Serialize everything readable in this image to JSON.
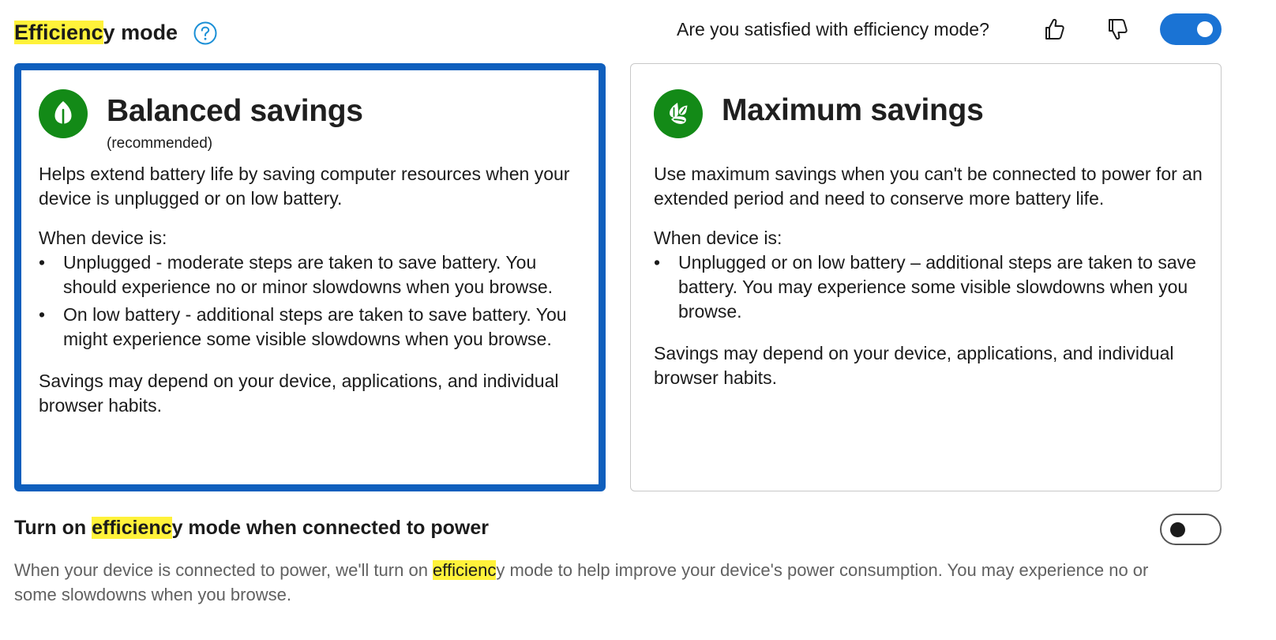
{
  "header": {
    "title_highlight": "Efficienc",
    "title_rest": "y mode",
    "help_icon": "question-circle-icon",
    "feedback_question": "Are you satisfied with efficiency mode?",
    "thumbs_up_icon": "thumbs-up-icon",
    "thumbs_down_icon": "thumbs-down-icon",
    "efficiency_toggle_on": true
  },
  "cards": {
    "balanced": {
      "icon": "leaf-icon",
      "title": "Balanced savings",
      "subtitle": "(recommended)",
      "description": "Helps extend battery life by saving computer resources when your device is unplugged or on low battery.",
      "when_label": "When device is:",
      "bullets": [
        "Unplugged - moderate steps are taken to save battery. You should experience no or minor slowdowns when you browse.",
        "On low battery - additional steps are taken to save battery. You might experience some visible slowdowns when you browse."
      ],
      "footer": "Savings may depend on your device, applications, and individual browser habits.",
      "selected": true
    },
    "maximum": {
      "icon": "leaves-icon",
      "title": "Maximum savings",
      "description": "Use maximum savings when you can't be connected to power for an extended period and need to conserve more battery life.",
      "when_label": "When device is:",
      "bullets": [
        "Unplugged or on low battery – additional steps are taken to save battery. You may experience some visible slowdowns when you browse."
      ],
      "footer": "Savings may depend on your device, applications, and individual browser habits.",
      "selected": false
    }
  },
  "bullet_char": "•",
  "power": {
    "title_before": "Turn on ",
    "title_highlight": "efficienc",
    "title_after": "y mode when connected to power",
    "desc_before": "When your device is connected to power, we'll turn on ",
    "desc_highlight": "efficienc",
    "desc_after": "y mode to help improve your device's power consumption. You may experience no or some slowdowns when you browse.",
    "toggle_on": false
  },
  "colors": {
    "accent": "#0f5fbd",
    "toggle_on": "#1a73d4",
    "icon_green": "#138a17",
    "highlight": "#fff23a",
    "muted_text": "#616161"
  }
}
